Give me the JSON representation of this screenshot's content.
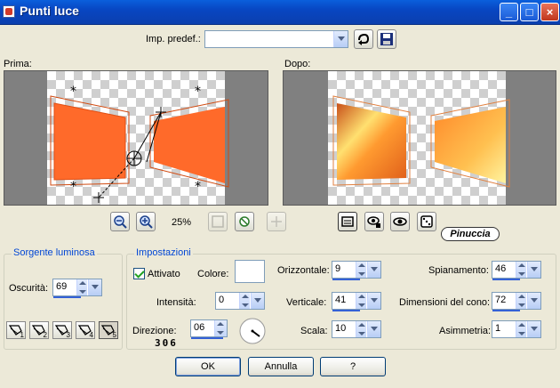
{
  "window": {
    "title": "Punti luce"
  },
  "toolbar": {
    "preset_label": "Imp. predef.:",
    "preset_value": ""
  },
  "before": {
    "label": "Prima:"
  },
  "after": {
    "label": "Dopo:"
  },
  "zoom": {
    "level": "25%"
  },
  "watermark": "Pinuccia",
  "light_source": {
    "title": "Sorgente luminosa",
    "darkness_label": "Oscurità:",
    "darkness_value": "69",
    "lamps": [
      "1",
      "2",
      "3",
      "4",
      "5"
    ],
    "selected_lamp": 5
  },
  "settings": {
    "title": "Impostazioni",
    "enabled_label": "Attivato",
    "color_label": "Colore:",
    "intensity_label": "Intensità:",
    "intensity_value": "0",
    "direction_label": "Direzione:",
    "direction_value": "06",
    "direction_readout": "306",
    "horizontal_label": "Orizzontale:",
    "horizontal_value": "9",
    "vertical_label": "Verticale:",
    "vertical_value": "41",
    "scale_label": "Scala:",
    "scale_value": "10",
    "smoothing_label": "Spianamento:",
    "smoothing_value": "46",
    "cone_label": "Dimensioni del cono:",
    "cone_value": "72",
    "asymmetry_label": "Asimmetria:",
    "asymmetry_value": "1"
  },
  "buttons": {
    "ok": "OK",
    "cancel": "Annulla",
    "help": "?"
  },
  "colors": {
    "accent": "#0046d5",
    "shape_orange": "#ff6a2a",
    "preview_gray": "#808080"
  }
}
